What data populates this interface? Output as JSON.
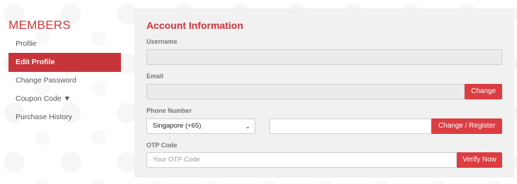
{
  "sidebar": {
    "title": "MEMBERS",
    "items": [
      {
        "label": "Profile"
      },
      {
        "label": "Edit Profile"
      },
      {
        "label": "Change Password"
      },
      {
        "label": "Coupon Code ▼"
      },
      {
        "label": "Purchase History"
      }
    ]
  },
  "panel": {
    "title": "Account Information",
    "username": {
      "label": "Username",
      "value": ""
    },
    "email": {
      "label": "Email",
      "value": "",
      "button": "Change"
    },
    "phone": {
      "label": "Phone Number",
      "country": "Singapore (+65)",
      "value": "",
      "button": "Change / Register"
    },
    "otp": {
      "label": "OTP Code",
      "placeholder": "Your OTP Code",
      "button": "Verify Now"
    }
  },
  "colors": {
    "accent": "#d0343a",
    "active": "#c7353b",
    "button": "#dc3d42"
  }
}
